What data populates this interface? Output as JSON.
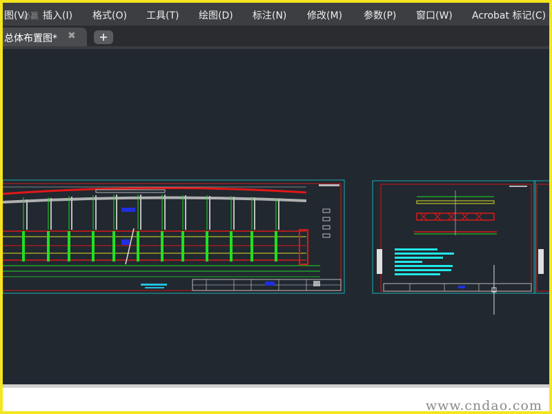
{
  "menu": {
    "items": [
      "图(V)",
      "插入(I)",
      "格式(O)",
      "工具(T)",
      "绘图(D)",
      "标注(N)",
      "修改(M)",
      "参数(P)",
      "窗口(W)",
      "Acrobat 标记(C)"
    ]
  },
  "tabs": {
    "active_label": "总体布置图*",
    "close_glyph": "✖",
    "new_glyph": "+"
  },
  "watermark": "www.cndao.com",
  "ghost_text": "必赢"
}
